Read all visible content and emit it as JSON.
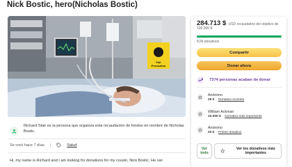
{
  "campaign": {
    "title": "Nick Bostic, hero(Nicholas Bostic)",
    "organizer_text": "Richard Stair es la persona que organiza esta recaudación de fondos en nombre de Nicholas Bostic.",
    "created": "Se creó hace 7 días",
    "separator": "|",
    "category": "Salud",
    "story_start": "Hi, my name is Richard and I am looking for donations for my cousin, Nick Bostic. He ran",
    "photo_sign": "Fall Precaution"
  },
  "panel": {
    "amount": "284.713 $",
    "goal_text": "USD recaudados del objetivo de 100.000 $",
    "progress_fraction": 1.0,
    "donations_count": "8,5k donativos",
    "share_label": "Compartir",
    "donate_label": "Donar ahora",
    "trend_text": "7374 personas acaban de donar",
    "donations": [
      {
        "name": "Anónimo",
        "amount": "25 $",
        "note": "Donativo reciente"
      },
      {
        "name": "William Ackman",
        "amount": "10.000 $",
        "note": "Donativo más importante"
      },
      {
        "name": "Anónimo",
        "amount": "20 $",
        "note": "Primer donativo"
      }
    ],
    "see_all_label": "Ver todo",
    "top_label": "Ver los donativos más importantes"
  },
  "colors": {
    "green": "#02a95c",
    "yellow": "#f6c247",
    "orange": "#eea72c",
    "purple": "#6b3fa0"
  }
}
